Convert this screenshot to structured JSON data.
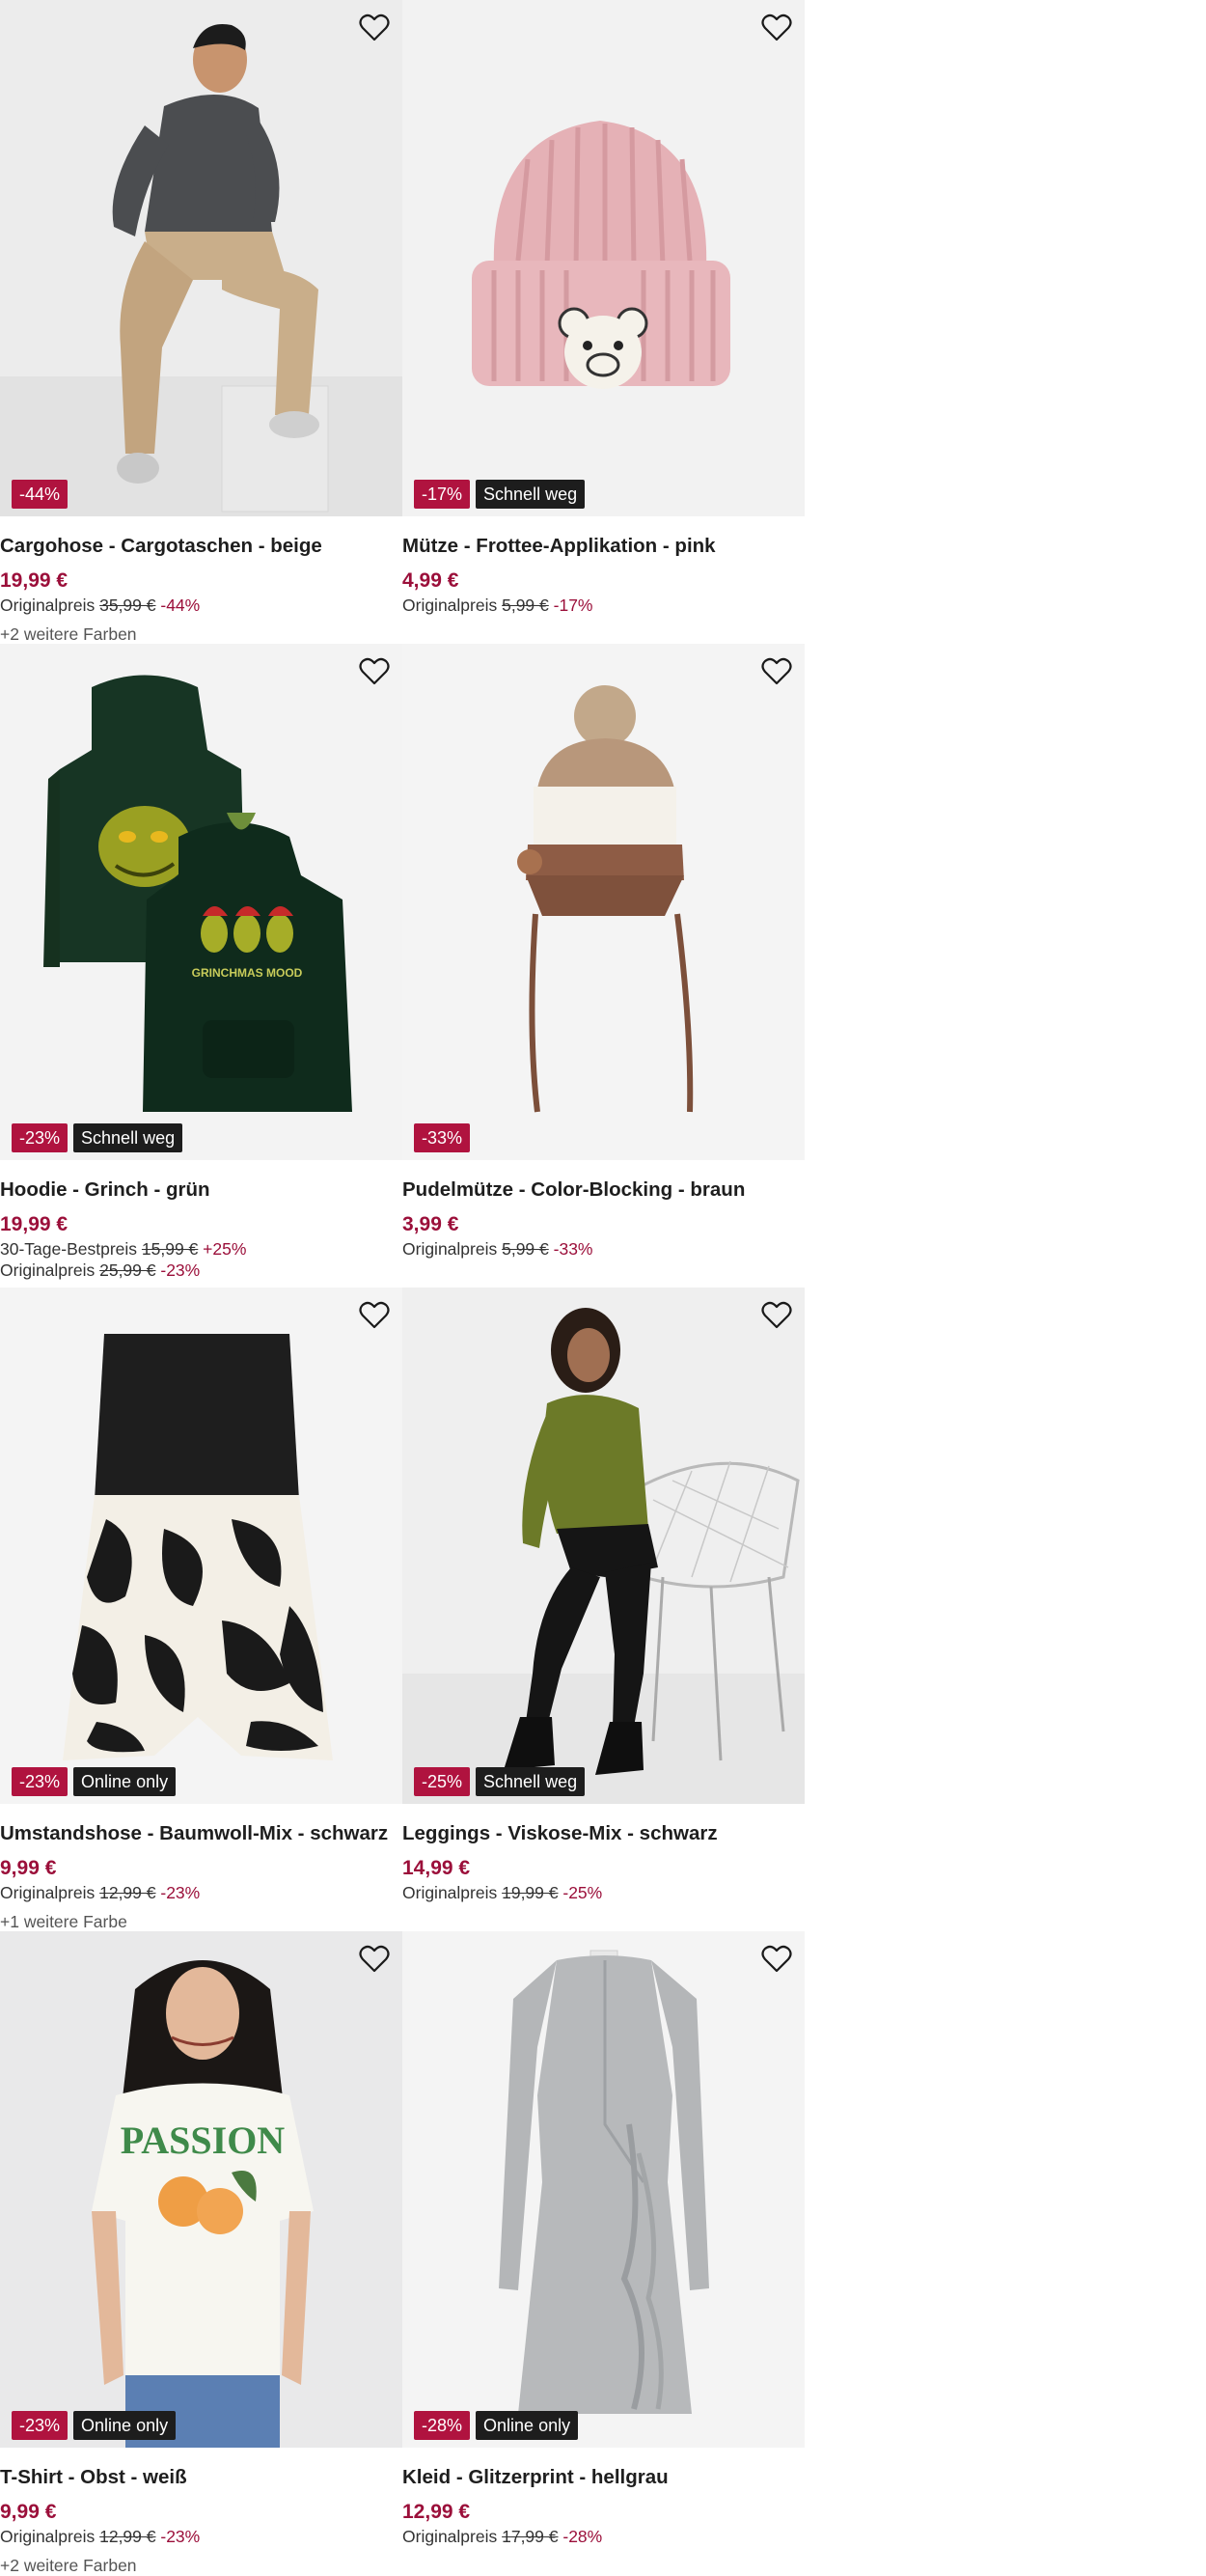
{
  "products": [
    {
      "title": "Cargohose - Cargotaschen - beige",
      "price": "19,99 €",
      "discount_badge": "-44%",
      "tag_badge": "",
      "ref_label": "",
      "ref_price": "",
      "ref_change": "",
      "orig_label": "Originalpreis",
      "orig_price": "35,99 €",
      "orig_change": "-44%",
      "more_colors": "+2 weitere Farben",
      "image": "man-cargo-pants"
    },
    {
      "title": "Mütze - Frottee-Applikation - pink",
      "price": "4,99 €",
      "discount_badge": "-17%",
      "tag_badge": "Schnell weg",
      "ref_label": "",
      "ref_price": "",
      "ref_change": "",
      "orig_label": "Originalpreis",
      "orig_price": "5,99 €",
      "orig_change": "-17%",
      "more_colors": "",
      "image": "pink-beanie-bear"
    },
    {
      "title": "Hoodie - Grinch - grün",
      "price": "19,99 €",
      "discount_badge": "-23%",
      "tag_badge": "Schnell weg",
      "ref_label": "30-Tage-Bestpreis",
      "ref_price": "15,99 €",
      "ref_change": "+25%",
      "orig_label": "Originalpreis",
      "orig_price": "25,99 €",
      "orig_change": "-23%",
      "more_colors": "",
      "image": "green-hoodies"
    },
    {
      "title": "Pudelmütze - Color-Blocking - braun",
      "price": "3,99 €",
      "discount_badge": "-33%",
      "tag_badge": "",
      "ref_label": "",
      "ref_price": "",
      "ref_change": "",
      "orig_label": "Originalpreis",
      "orig_price": "5,99 €",
      "orig_change": "-33%",
      "more_colors": "",
      "image": "brown-pompom-hat"
    },
    {
      "title": "Umstandshose - Baumwoll-Mix - schwarz",
      "price": "9,99 €",
      "discount_badge": "-23%",
      "tag_badge": "Online only",
      "ref_label": "",
      "ref_price": "",
      "ref_change": "",
      "orig_label": "Originalpreis",
      "orig_price": "12,99 €",
      "orig_change": "-23%",
      "more_colors": "+1 weitere Farbe",
      "image": "maternity-shorts"
    },
    {
      "title": "Leggings - Viskose-Mix - schwarz",
      "price": "14,99 €",
      "discount_badge": "-25%",
      "tag_badge": "Schnell weg",
      "ref_label": "",
      "ref_price": "",
      "ref_change": "",
      "orig_label": "Originalpreis",
      "orig_price": "19,99 €",
      "orig_change": "-25%",
      "more_colors": "",
      "image": "woman-leggings-chair"
    },
    {
      "title": "T-Shirt - Obst - weiß",
      "price": "9,99 €",
      "discount_badge": "-23%",
      "tag_badge": "Online only",
      "ref_label": "",
      "ref_price": "",
      "ref_change": "",
      "orig_label": "Originalpreis",
      "orig_price": "12,99 €",
      "orig_change": "-23%",
      "more_colors": "+2 weitere Farben",
      "image": "woman-tshirt-passion"
    },
    {
      "title": "Kleid - Glitzerprint - hellgrau",
      "price": "12,99 €",
      "discount_badge": "-28%",
      "tag_badge": "Online only",
      "ref_label": "",
      "ref_price": "",
      "ref_change": "",
      "orig_label": "Originalpreis",
      "orig_price": "17,99 €",
      "orig_change": "-28%",
      "more_colors": "",
      "image": "grey-wrap-dress"
    }
  ],
  "shirt_print_text": "PASSION",
  "hoodie_print_text": "GRINCHMAS MOOD",
  "icons": {
    "wishlist": "heart-outline-icon"
  },
  "colors": {
    "discount_badge": "#b0133f",
    "tag_badge": "#1d1d1d",
    "price": "#9b0f3a",
    "image_bg": "#f3f3f3"
  }
}
